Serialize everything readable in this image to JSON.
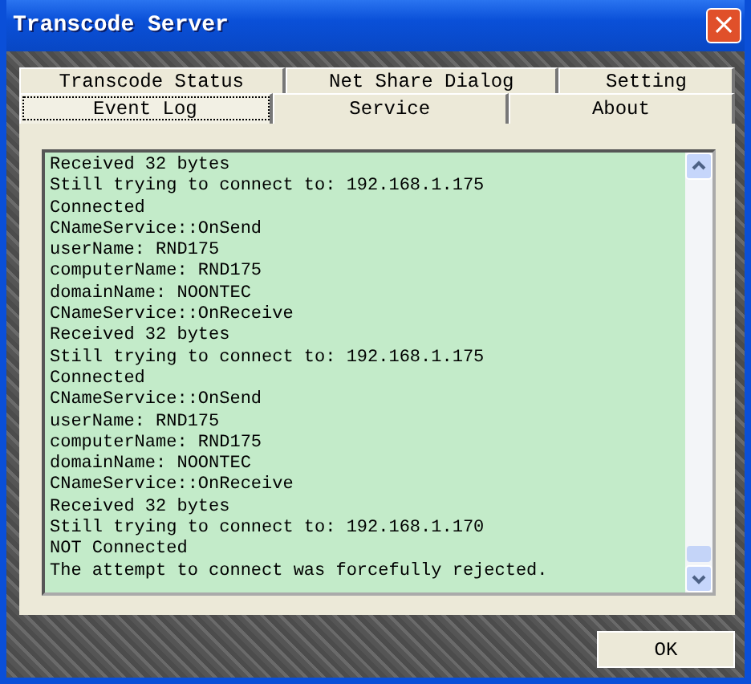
{
  "window": {
    "title": "Transcode Server",
    "close": "×"
  },
  "tab_rows": [
    {
      "tabs": [
        {
          "label": "Transcode Status",
          "selected": false
        },
        {
          "label": "Net Share Dialog",
          "selected": false
        },
        {
          "label": "Setting",
          "selected": false
        }
      ]
    },
    {
      "tabs": [
        {
          "label": "Event Log",
          "selected": true
        },
        {
          "label": "Service",
          "selected": false
        },
        {
          "label": "About",
          "selected": false
        }
      ]
    }
  ],
  "event_log": [
    "Received 32 bytes",
    "Still trying to connect to: 192.168.1.175",
    "Connected",
    "CNameService::OnSend",
    "userName: RND175",
    "computerName: RND175",
    "domainName: NOONTEC",
    "CNameService::OnReceive",
    "Received 32 bytes",
    "Still trying to connect to: 192.168.1.175",
    "Connected",
    "CNameService::OnSend",
    "userName: RND175",
    "computerName: RND175",
    "domainName: NOONTEC",
    "CNameService::OnReceive",
    "Received 32 bytes",
    "Still trying to connect to: 192.168.1.170",
    "NOT Connected",
    "The attempt to connect was forcefully rejected."
  ],
  "buttons": [
    {
      "label": "OK"
    }
  ]
}
